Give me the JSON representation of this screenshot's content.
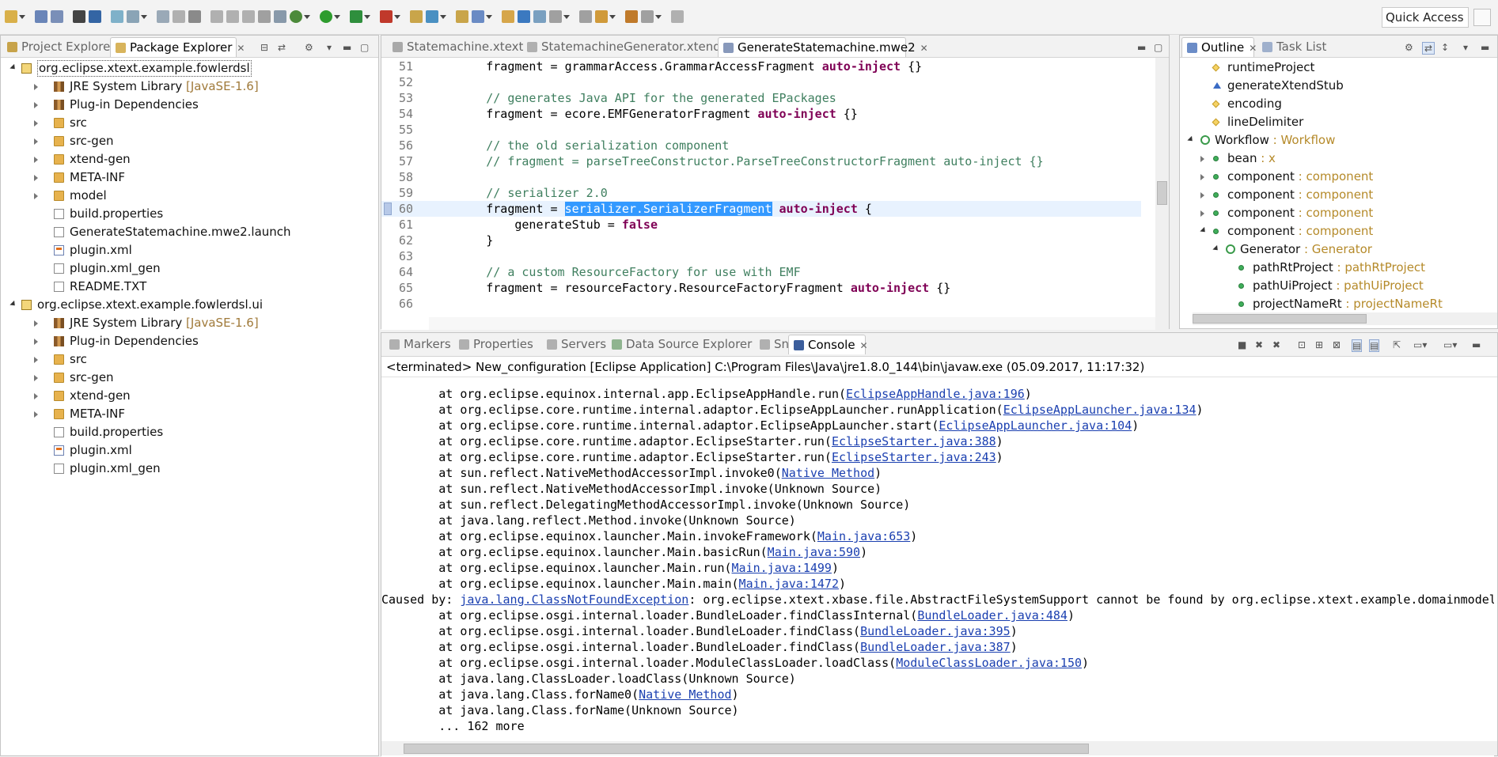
{
  "toolbar": {
    "quick_access": "Quick Access"
  },
  "left_panel": {
    "tabs": [
      {
        "label": "Project Explorer",
        "active": false
      },
      {
        "label": "Package Explorer",
        "active": true
      }
    ],
    "tree": [
      {
        "label": "org.eclipse.xtext.example.fowlerdsl",
        "sub": "",
        "icon": "project-icon",
        "depth": 0,
        "twisty": "open"
      },
      {
        "label": "JRE System Library",
        "sub": "[JavaSE-1.6]",
        "icon": "library-icon",
        "depth": 1,
        "twisty": "closed"
      },
      {
        "label": "Plug-in Dependencies",
        "sub": "",
        "icon": "library-icon",
        "depth": 1,
        "twisty": "closed"
      },
      {
        "label": "src",
        "sub": "",
        "icon": "source-folder-icon",
        "depth": 1,
        "twisty": "closed"
      },
      {
        "label": "src-gen",
        "sub": "",
        "icon": "source-folder-icon",
        "depth": 1,
        "twisty": "closed"
      },
      {
        "label": "xtend-gen",
        "sub": "",
        "icon": "source-folder-icon",
        "depth": 1,
        "twisty": "closed"
      },
      {
        "label": "META-INF",
        "sub": "",
        "icon": "folder-icon",
        "depth": 1,
        "twisty": "closed"
      },
      {
        "label": "model",
        "sub": "",
        "icon": "folder-icon",
        "depth": 1,
        "twisty": "closed"
      },
      {
        "label": "build.properties",
        "sub": "",
        "icon": "file-icon",
        "depth": 1,
        "twisty": "none"
      },
      {
        "label": "GenerateStatemachine.mwe2.launch",
        "sub": "",
        "icon": "file-icon",
        "depth": 1,
        "twisty": "none"
      },
      {
        "label": "plugin.xml",
        "sub": "",
        "icon": "xml-icon",
        "depth": 1,
        "twisty": "none"
      },
      {
        "label": "plugin.xml_gen",
        "sub": "",
        "icon": "file-icon",
        "depth": 1,
        "twisty": "none"
      },
      {
        "label": "README.TXT",
        "sub": "",
        "icon": "file-icon",
        "depth": 1,
        "twisty": "none"
      },
      {
        "label": "org.eclipse.xtext.example.fowlerdsl.ui",
        "sub": "",
        "icon": "project-icon",
        "depth": 0,
        "twisty": "open"
      },
      {
        "label": "JRE System Library",
        "sub": "[JavaSE-1.6]",
        "icon": "library-icon",
        "depth": 1,
        "twisty": "closed"
      },
      {
        "label": "Plug-in Dependencies",
        "sub": "",
        "icon": "library-icon",
        "depth": 1,
        "twisty": "closed"
      },
      {
        "label": "src",
        "sub": "",
        "icon": "source-folder-icon",
        "depth": 1,
        "twisty": "closed"
      },
      {
        "label": "src-gen",
        "sub": "",
        "icon": "source-folder-icon",
        "depth": 1,
        "twisty": "closed"
      },
      {
        "label": "xtend-gen",
        "sub": "",
        "icon": "source-folder-icon",
        "depth": 1,
        "twisty": "closed"
      },
      {
        "label": "META-INF",
        "sub": "",
        "icon": "folder-icon",
        "depth": 1,
        "twisty": "closed"
      },
      {
        "label": "build.properties",
        "sub": "",
        "icon": "file-icon",
        "depth": 1,
        "twisty": "none"
      },
      {
        "label": "plugin.xml",
        "sub": "",
        "icon": "xml-icon",
        "depth": 1,
        "twisty": "none"
      },
      {
        "label": "plugin.xml_gen",
        "sub": "",
        "icon": "file-icon",
        "depth": 1,
        "twisty": "none"
      }
    ]
  },
  "editor": {
    "tabs": [
      {
        "label": "Statemachine.xtext",
        "active": false
      },
      {
        "label": "StatemachineGenerator.xtend",
        "active": false
      },
      {
        "label": "GenerateStatemachine.mwe2",
        "active": true
      }
    ],
    "lines": [
      {
        "num": "51",
        "parts": [
          {
            "t": "        fragment = grammarAccess.GrammarAccessFragment ",
            "c": ""
          },
          {
            "t": "auto-inject",
            "c": "kw"
          },
          {
            "t": " {}",
            "c": ""
          }
        ]
      },
      {
        "num": "52",
        "parts": []
      },
      {
        "num": "53",
        "parts": [
          {
            "t": "        // generates Java API for the generated EPackages",
            "c": "cm"
          }
        ]
      },
      {
        "num": "54",
        "parts": [
          {
            "t": "        fragment = ecore.EMFGeneratorFragment ",
            "c": ""
          },
          {
            "t": "auto-inject",
            "c": "kw"
          },
          {
            "t": " {}",
            "c": ""
          }
        ]
      },
      {
        "num": "55",
        "parts": []
      },
      {
        "num": "56",
        "parts": [
          {
            "t": "        // the old serialization component",
            "c": "cm"
          }
        ]
      },
      {
        "num": "57",
        "parts": [
          {
            "t": "        // fragment = parseTreeConstructor.ParseTreeConstructorFragment auto-inject {}",
            "c": "cm"
          }
        ]
      },
      {
        "num": "58",
        "parts": []
      },
      {
        "num": "59",
        "parts": [
          {
            "t": "        // serializer 2.0",
            "c": "cm"
          }
        ]
      },
      {
        "num": "60",
        "parts": [
          {
            "t": "        fragment = ",
            "c": ""
          },
          {
            "t": "serializer.SerializerFragment",
            "c": "sel"
          },
          {
            "t": " ",
            "c": ""
          },
          {
            "t": "auto-inject",
            "c": "kw"
          },
          {
            "t": " {",
            "c": ""
          }
        ],
        "current": true
      },
      {
        "num": "61",
        "parts": [
          {
            "t": "            generateStub = ",
            "c": ""
          },
          {
            "t": "false",
            "c": "kw"
          }
        ]
      },
      {
        "num": "62",
        "parts": [
          {
            "t": "        }",
            "c": ""
          }
        ]
      },
      {
        "num": "63",
        "parts": []
      },
      {
        "num": "64",
        "parts": [
          {
            "t": "        // a custom ResourceFactory for use with EMF",
            "c": "cm"
          }
        ]
      },
      {
        "num": "65",
        "parts": [
          {
            "t": "        fragment = resourceFactory.ResourceFactoryFragment ",
            "c": ""
          },
          {
            "t": "auto-inject",
            "c": "kw"
          },
          {
            "t": " {}",
            "c": ""
          }
        ]
      },
      {
        "num": "66",
        "parts": []
      }
    ]
  },
  "outline": {
    "tabs": [
      {
        "label": "Outline",
        "active": true
      },
      {
        "label": "Task List",
        "active": false
      }
    ],
    "rows": [
      {
        "label": "runtimeProject",
        "type": "",
        "icon": "diamond-icon",
        "depth": 1,
        "twisty": "none"
      },
      {
        "label": "generateXtendStub",
        "type": "",
        "icon": "triangle-icon",
        "depth": 1,
        "twisty": "none"
      },
      {
        "label": "encoding",
        "type": "",
        "icon": "diamond-icon",
        "depth": 1,
        "twisty": "none"
      },
      {
        "label": "lineDelimiter",
        "type": "",
        "icon": "diamond-icon",
        "depth": 1,
        "twisty": "none"
      },
      {
        "label": "Workflow",
        "type": " : Workflow",
        "icon": "component-root-icon",
        "depth": 0,
        "twisty": "open"
      },
      {
        "label": "bean",
        "type": " : x",
        "icon": "green-dot-icon",
        "depth": 1,
        "twisty": "closed"
      },
      {
        "label": "component",
        "type": " : component",
        "icon": "green-dot-icon",
        "depth": 1,
        "twisty": "closed"
      },
      {
        "label": "component",
        "type": " : component",
        "icon": "green-dot-icon",
        "depth": 1,
        "twisty": "closed"
      },
      {
        "label": "component",
        "type": " : component",
        "icon": "green-dot-icon",
        "depth": 1,
        "twisty": "closed"
      },
      {
        "label": "component",
        "type": " : component",
        "icon": "green-dot-icon",
        "depth": 1,
        "twisty": "open"
      },
      {
        "label": "Generator",
        "type": " : Generator",
        "icon": "component-root-icon",
        "depth": 2,
        "twisty": "open"
      },
      {
        "label": "pathRtProject",
        "type": " : pathRtProject",
        "icon": "green-dot-icon",
        "depth": 3,
        "twisty": "none"
      },
      {
        "label": "pathUiProject",
        "type": " : pathUiProject",
        "icon": "green-dot-icon",
        "depth": 3,
        "twisty": "none"
      },
      {
        "label": "projectNameRt",
        "type": " : projectNameRt",
        "icon": "green-dot-icon",
        "depth": 3,
        "twisty": "none"
      }
    ]
  },
  "console": {
    "tabs": [
      {
        "label": "Markers",
        "active": false
      },
      {
        "label": "Properties",
        "active": false
      },
      {
        "label": "Servers",
        "active": false
      },
      {
        "label": "Data Source Explorer",
        "active": false
      },
      {
        "label": "Snippets",
        "active": false
      },
      {
        "label": "Console",
        "active": true
      }
    ],
    "status": "<terminated> New_configuration [Eclipse Application] C:\\Program Files\\Java\\jre1.8.0_144\\bin\\javaw.exe (05.09.2017, 11:17:32)",
    "lines": [
      {
        "pre": "        at org.eclipse.equinox.internal.app.EclipseAppHandle.run(",
        "link": "EclipseAppHandle.java:196",
        "post": ")"
      },
      {
        "pre": "        at org.eclipse.core.runtime.internal.adaptor.EclipseAppLauncher.runApplication(",
        "link": "EclipseAppLauncher.java:134",
        "post": ")"
      },
      {
        "pre": "        at org.eclipse.core.runtime.internal.adaptor.EclipseAppLauncher.start(",
        "link": "EclipseAppLauncher.java:104",
        "post": ")"
      },
      {
        "pre": "        at org.eclipse.core.runtime.adaptor.EclipseStarter.run(",
        "link": "EclipseStarter.java:388",
        "post": ")"
      },
      {
        "pre": "        at org.eclipse.core.runtime.adaptor.EclipseStarter.run(",
        "link": "EclipseStarter.java:243",
        "post": ")"
      },
      {
        "pre": "        at sun.reflect.NativeMethodAccessorImpl.invoke0(",
        "link": "Native Method",
        "post": ")"
      },
      {
        "pre": "        at sun.reflect.NativeMethodAccessorImpl.invoke(Unknown Source)",
        "link": "",
        "post": ""
      },
      {
        "pre": "        at sun.reflect.DelegatingMethodAccessorImpl.invoke(Unknown Source)",
        "link": "",
        "post": ""
      },
      {
        "pre": "        at java.lang.reflect.Method.invoke(Unknown Source)",
        "link": "",
        "post": ""
      },
      {
        "pre": "        at org.eclipse.equinox.launcher.Main.invokeFramework(",
        "link": "Main.java:653",
        "post": ")"
      },
      {
        "pre": "        at org.eclipse.equinox.launcher.Main.basicRun(",
        "link": "Main.java:590",
        "post": ")"
      },
      {
        "pre": "        at org.eclipse.equinox.launcher.Main.run(",
        "link": "Main.java:1499",
        "post": ")"
      },
      {
        "pre": "        at org.eclipse.equinox.launcher.Main.main(",
        "link": "Main.java:1472",
        "post": ")"
      },
      {
        "pre": "Caused by: ",
        "link": "java.lang.ClassNotFoundException",
        "post": ": org.eclipse.xtext.xbase.file.AbstractFileSystemSupport cannot be found by org.eclipse.xtext.example.domainmodel"
      },
      {
        "pre": "        at org.eclipse.osgi.internal.loader.BundleLoader.findClassInternal(",
        "link": "BundleLoader.java:484",
        "post": ")"
      },
      {
        "pre": "        at org.eclipse.osgi.internal.loader.BundleLoader.findClass(",
        "link": "BundleLoader.java:395",
        "post": ")"
      },
      {
        "pre": "        at org.eclipse.osgi.internal.loader.BundleLoader.findClass(",
        "link": "BundleLoader.java:387",
        "post": ")"
      },
      {
        "pre": "        at org.eclipse.osgi.internal.loader.ModuleClassLoader.loadClass(",
        "link": "ModuleClassLoader.java:150",
        "post": ")"
      },
      {
        "pre": "        at java.lang.ClassLoader.loadClass(Unknown Source)",
        "link": "",
        "post": ""
      },
      {
        "pre": "        at java.lang.Class.forName0(",
        "link": "Native Method",
        "post": ")"
      },
      {
        "pre": "        at java.lang.Class.forName(Unknown Source)",
        "link": "",
        "post": ""
      },
      {
        "pre": "        ... 162 more",
        "link": "",
        "post": ""
      }
    ]
  },
  "colors": {
    "keyword": "#7f0055",
    "comment": "#3f7f5f",
    "selection": "#3399ff",
    "link": "#1a3fb0",
    "type_label": "#b58a2a"
  }
}
